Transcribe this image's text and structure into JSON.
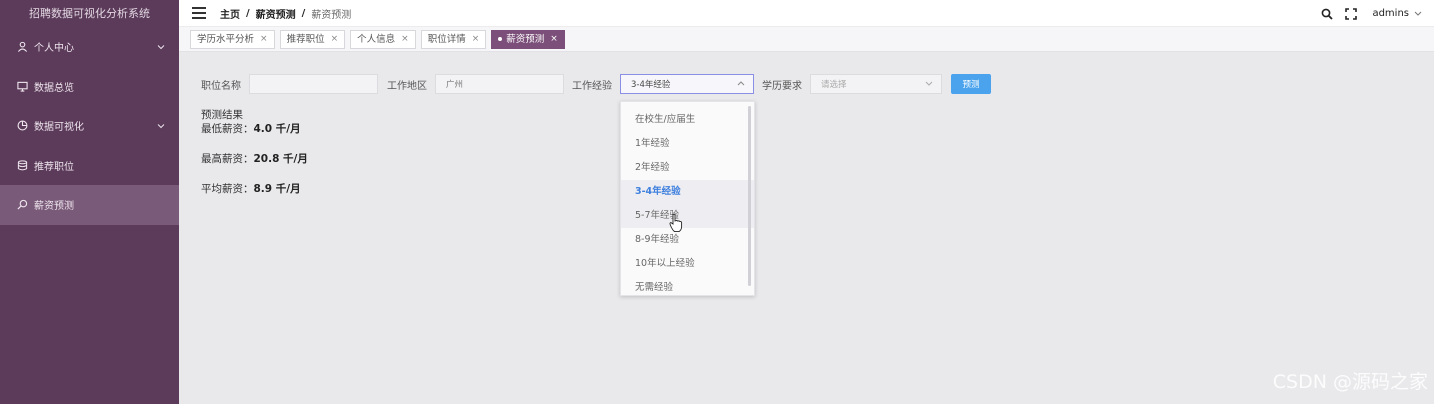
{
  "app": {
    "title": "招聘数据可视化分析系统"
  },
  "sidebar": {
    "items": [
      {
        "label": "个人中心",
        "icon": "user-icon",
        "expandable": true
      },
      {
        "label": "数据总览",
        "icon": "monitor-icon",
        "expandable": false
      },
      {
        "label": "数据可视化",
        "icon": "pie-chart-icon",
        "expandable": true
      },
      {
        "label": "推荐职位",
        "icon": "database-icon",
        "expandable": false
      },
      {
        "label": "薪资预测",
        "icon": "search-icon",
        "expandable": false,
        "active": true
      }
    ]
  },
  "header": {
    "breadcrumb": [
      "主页",
      "薪资预测",
      "薪资预测"
    ],
    "user": "admins"
  },
  "tabs": [
    {
      "label": "学历水平分析"
    },
    {
      "label": "推荐职位"
    },
    {
      "label": "个人信息"
    },
    {
      "label": "职位详情"
    },
    {
      "label": "薪资预测",
      "active": true
    }
  ],
  "form": {
    "job_label": "职位名称",
    "job_value": "",
    "area_label": "工作地区",
    "area_value": "广州",
    "exp_label": "工作经验",
    "exp_value": "3-4年经验",
    "edu_label": "学历要求",
    "edu_placeholder": "请选择",
    "submit_label": "预测"
  },
  "result": {
    "title": "预测结果",
    "min_label": "最低薪资：",
    "min_value": "4.0 千/月",
    "max_label": "最高薪资：",
    "max_value": "20.8 千/月",
    "avg_label": "平均薪资：",
    "avg_value": "8.9 千/月"
  },
  "dropdown": {
    "options": [
      "在校生/应届生",
      "1年经验",
      "2年经验",
      "3-4年经验",
      "5-7年经验",
      "8-9年经验",
      "10年以上经验",
      "无需经验"
    ],
    "selected": "3-4年经验",
    "hovered": "5-7年经验"
  },
  "watermark": "CSDN @源码之家",
  "colors": {
    "sidebar": "#5b3a5a",
    "active_tab": "#7b4f79",
    "primary_button": "#4aa3ec",
    "selected_option": "#3e7fde"
  }
}
